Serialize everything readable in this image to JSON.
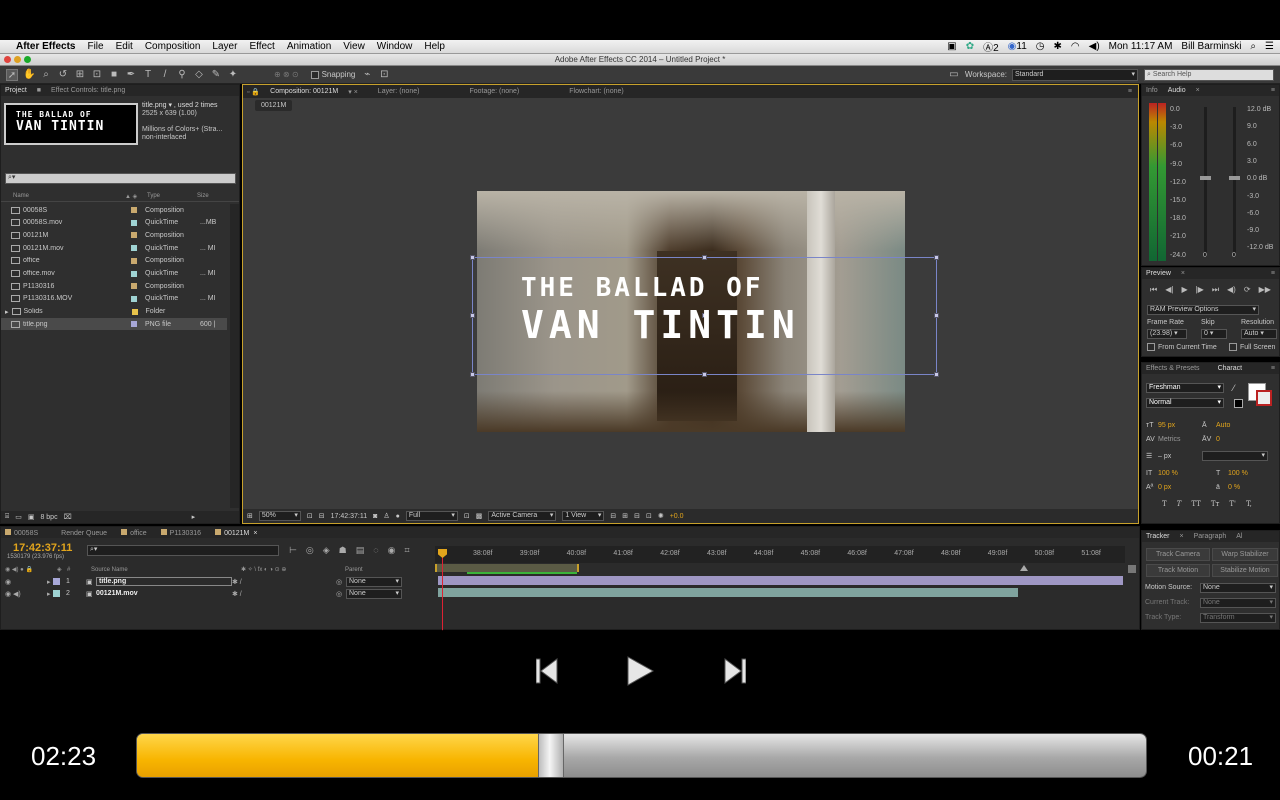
{
  "mac_menu": {
    "app_name": "After Effects",
    "items": [
      "File",
      "Edit",
      "Composition",
      "Layer",
      "Effect",
      "Animation",
      "View",
      "Window",
      "Help"
    ],
    "status_badge_2": "2",
    "status_badge_11": "11",
    "clock": "Mon 11:17 AM",
    "user": "Bill Barminski"
  },
  "window": {
    "title": "Adobe After Effects CC 2014 – Untitled Project *"
  },
  "toolbar": {
    "snapping_label": "Snapping",
    "workspace_label": "Workspace:",
    "workspace_value": "Standard",
    "search_help_placeholder": "Search Help"
  },
  "project_panel": {
    "tab_project": "Project",
    "tab_effect_controls": "Effect Controls: title.png",
    "thumb_line1": "THE BALLAD OF",
    "thumb_line2": "VAN TINTIN",
    "info_name": "title.png ▾ , used 2 times",
    "info_dims": "2525 x 639 (1.00)",
    "info_colors": "Millions of Colors+ (Stra...",
    "info_interlace": "non-interlaced",
    "col_name": "Name",
    "col_type": "Type",
    "col_size": "Size",
    "bpc": "8 bpc",
    "items": [
      {
        "name": "00058S",
        "type": "Composition",
        "size": "",
        "color": "#c9a96e"
      },
      {
        "name": "00058S.mov",
        "type": "QuickTime",
        "size": "...MB",
        "color": "#9fd3d3"
      },
      {
        "name": "00121M",
        "type": "Composition",
        "size": "",
        "color": "#c9a96e"
      },
      {
        "name": "00121M.mov",
        "type": "QuickTime",
        "size": "... MI",
        "color": "#9fd3d3"
      },
      {
        "name": "office",
        "type": "Composition",
        "size": "",
        "color": "#c9a96e"
      },
      {
        "name": "office.mov",
        "type": "QuickTime",
        "size": "... MI",
        "color": "#9fd3d3"
      },
      {
        "name": "P1130316",
        "type": "Composition",
        "size": "",
        "color": "#c9a96e"
      },
      {
        "name": "P1130316.MOV",
        "type": "QuickTime",
        "size": "... MI",
        "color": "#9fd3d3"
      },
      {
        "name": "Solids",
        "type": "Folder",
        "size": "",
        "color": "#e8c34b"
      },
      {
        "name": "title.png",
        "type": "PNG file",
        "size": "600 |",
        "color": "#a8a8d8"
      }
    ]
  },
  "comp_panel": {
    "tab_composition": "Composition: 00121M",
    "tab_layer": "Layer: (none)",
    "tab_footage": "Footage: (none)",
    "tab_flowchart": "Flowchart: (none)",
    "comp_chip": "00121M",
    "title_line1": "THE BALLAD OF",
    "title_line2": "VAN TINTIN",
    "zoom": "50%",
    "timecode": "17:42:37:11",
    "resolution": "Full",
    "camera": "Active Camera",
    "views": "1 View",
    "exposure": "+0.0"
  },
  "info_audio": {
    "tab_info": "Info",
    "tab_audio": "Audio",
    "left_scale": [
      "0.0",
      "-3.0",
      "-6.0",
      "-9.0",
      "-12.0",
      "-15.0",
      "-18.0",
      "-21.0",
      "-24.0"
    ],
    "right_scale": [
      "12.0 dB",
      "9.0",
      "6.0",
      "3.0",
      "0.0 dB",
      "-3.0",
      "-6.0",
      "-9.0",
      "-12.0 dB"
    ],
    "zero_a": "0",
    "zero_b": "0"
  },
  "preview": {
    "tab": "Preview",
    "ram_options": "RAM Preview Options",
    "frame_rate_label": "Frame Rate",
    "skip_label": "Skip",
    "resolution_label": "Resolution",
    "frame_rate_value": "(23.98)",
    "skip_value": "0",
    "resolution_value": "Auto",
    "from_current": "From Current Time",
    "full_screen": "Full Screen"
  },
  "character": {
    "tab_effects": "Effects & Presets",
    "tab_character": "Charact",
    "font": "Freshman",
    "style": "Normal",
    "size": "95 px",
    "leading": "Auto",
    "kerning": "Metrics",
    "tracking": "0",
    "stroke": "– px",
    "vscale": "100 %",
    "hscale": "100 %",
    "baseline": "0 px",
    "tsume": "0 %",
    "type_buttons": [
      "T",
      "T",
      "TT",
      "Tт",
      "T'",
      "T,"
    ]
  },
  "tracker": {
    "tab_tracker": "Tracker",
    "tab_paragraph": "Paragraph",
    "tab_align": "Al",
    "track_camera": "Track Camera",
    "warp_stabilizer": "Warp Stabilizer",
    "track_motion": "Track Motion",
    "stabilize_motion": "Stabilize Motion",
    "motion_source_label": "Motion Source:",
    "motion_source_value": "None",
    "current_track_label": "Current Track:",
    "current_track_value": "None",
    "track_type_label": "Track Type:",
    "track_type_value": "Transform"
  },
  "timeline": {
    "tabs": [
      "00058S",
      "Render Queue",
      "office",
      "P1130316",
      "00121M"
    ],
    "timecode": "17:42:37:11",
    "frames": "1530179 (23.976 fps)",
    "col_hash": "#",
    "col_source": "Source Name",
    "col_parent": "Parent",
    "ruler": [
      "38:08f",
      "39:08f",
      "40:08f",
      "41:08f",
      "42:08f",
      "43:08f",
      "44:08f",
      "45:08f",
      "46:08f",
      "47:08f",
      "48:08f",
      "49:08f",
      "50:08f",
      "51:08f"
    ],
    "layers": [
      {
        "num": "1",
        "name": "title.png",
        "parent": "None",
        "color": "#a8a8d8"
      },
      {
        "num": "2",
        "name": "00121M.mov",
        "parent": "None",
        "color": "#9fd3d3"
      }
    ]
  },
  "player": {
    "elapsed": "02:23",
    "remaining": "00:21",
    "progress": 0.41,
    "colors": {
      "fill": "#f8b500",
      "track": "#a8a8a8"
    }
  }
}
